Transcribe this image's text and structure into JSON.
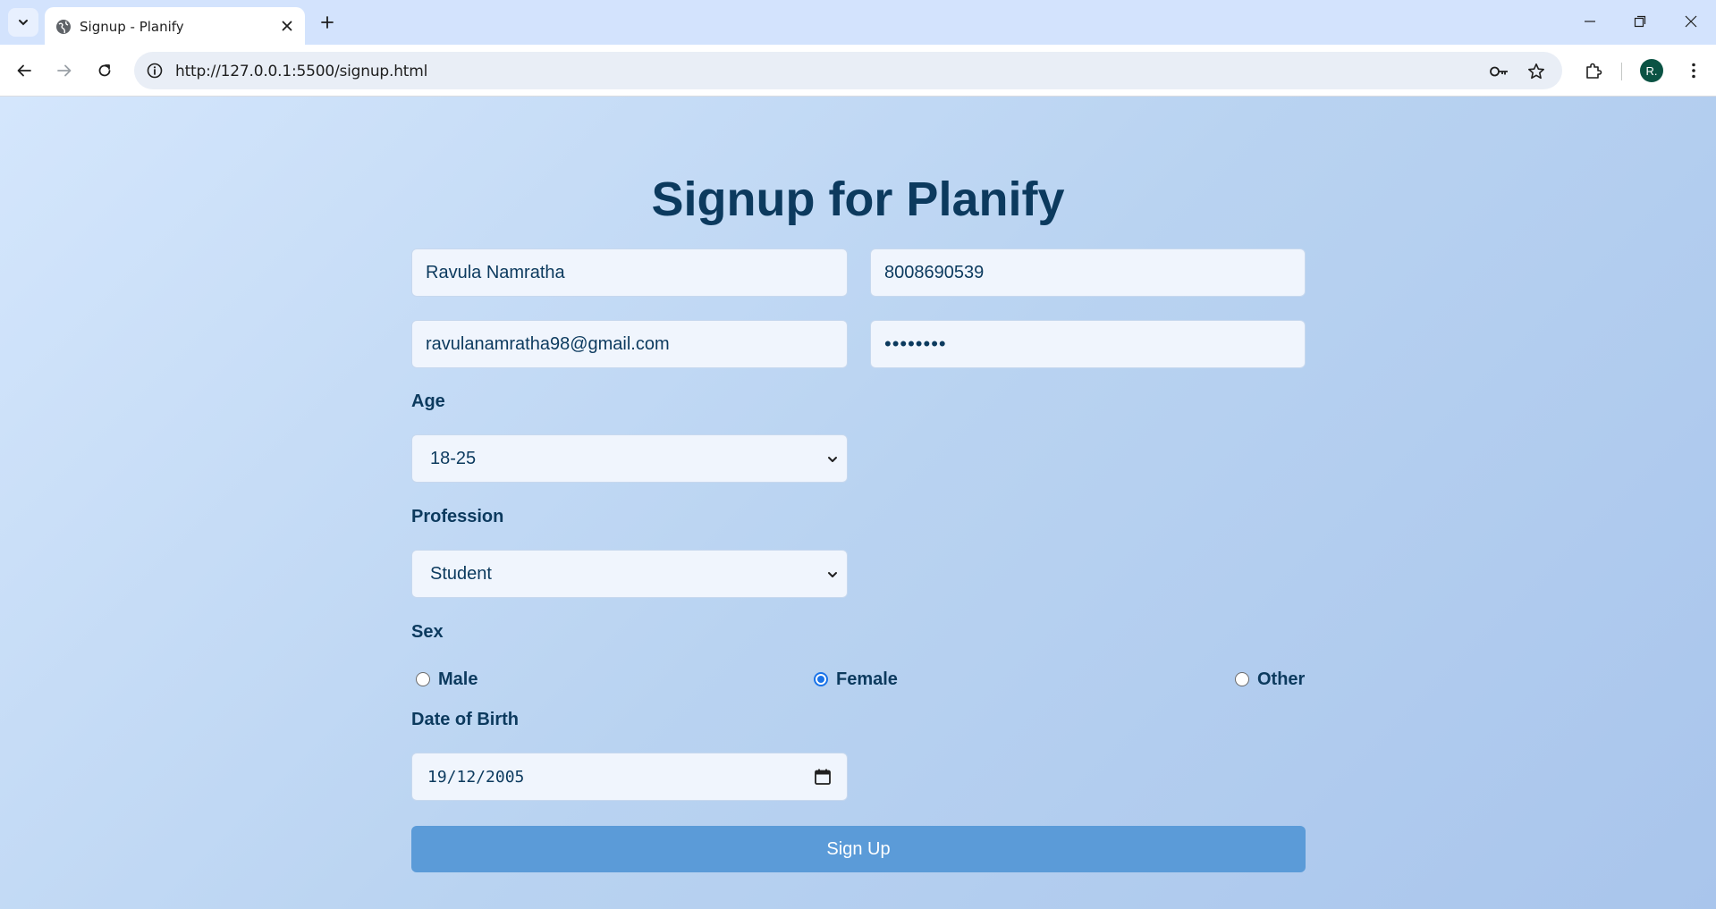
{
  "browser": {
    "tab_title": "Signup - Planify",
    "url": "http://127.0.0.1:5500/signup.html",
    "profile_initial": "R."
  },
  "form": {
    "title": "Signup for Planify",
    "name_value": "Ravula Namratha",
    "phone_value": "8008690539",
    "email_value": "ravulanamratha98@gmail.com",
    "password_masked": "••••••••",
    "age_label": "Age",
    "age_selected": "18-25",
    "profession_label": "Profession",
    "profession_selected": "Student",
    "sex_label": "Sex",
    "sex_options": [
      {
        "label": "Male",
        "checked": false
      },
      {
        "label": "Female",
        "checked": true
      },
      {
        "label": "Other",
        "checked": false
      }
    ],
    "dob_label": "Date of Birth",
    "dob_value": "19/12/2005",
    "submit_label": "Sign Up"
  },
  "colors": {
    "heading": "#0c3a5e",
    "button": "#5b9bd8",
    "radio_accent": "#1a73e8"
  }
}
